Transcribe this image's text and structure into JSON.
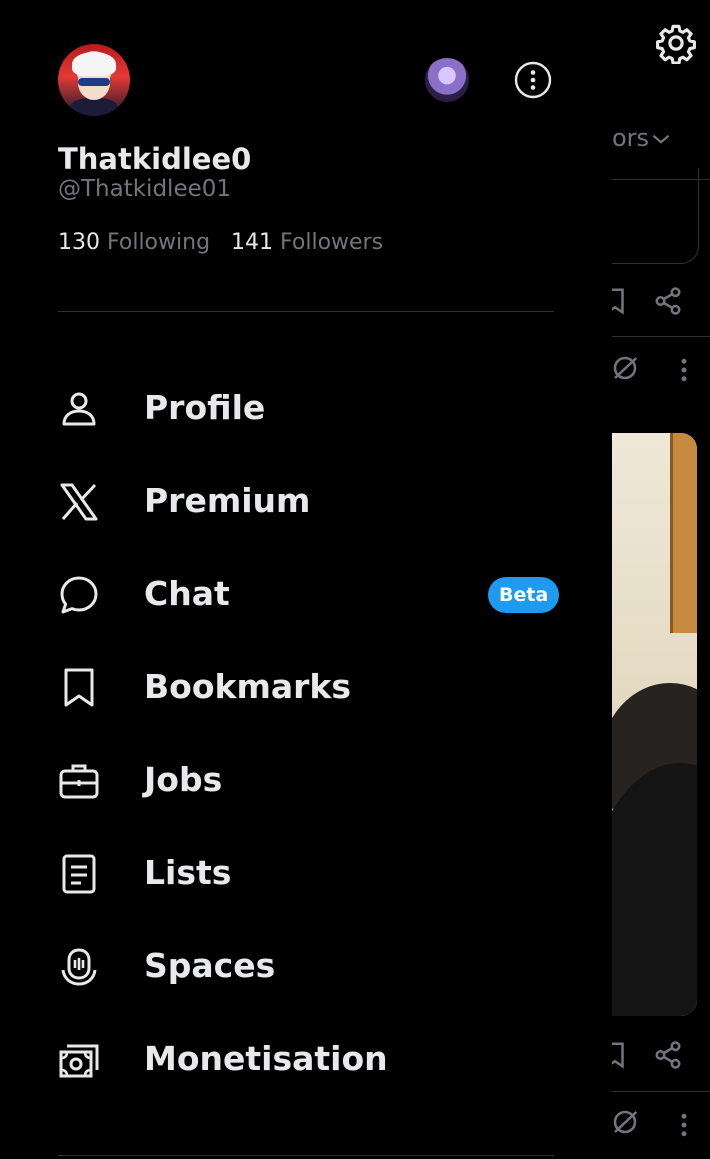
{
  "profile": {
    "display_name": "Thatkidlee0",
    "handle": "@Thatkidlee01",
    "following_count": "130",
    "following_label": "Following",
    "followers_count": "141",
    "followers_label": "Followers"
  },
  "background": {
    "sort_text": "ors"
  },
  "menu": [
    {
      "label": "Profile",
      "icon": "person-icon"
    },
    {
      "label": "Premium",
      "icon": "x-logo-icon"
    },
    {
      "label": "Chat",
      "icon": "chat-bubble-icon",
      "badge": "Beta"
    },
    {
      "label": "Bookmarks",
      "icon": "bookmark-icon"
    },
    {
      "label": "Jobs",
      "icon": "briefcase-icon"
    },
    {
      "label": "Lists",
      "icon": "list-icon"
    },
    {
      "label": "Spaces",
      "icon": "spaces-mic-icon"
    },
    {
      "label": "Monetisation",
      "icon": "money-icon"
    }
  ],
  "colors": {
    "background": "#000000",
    "text_primary": "#e7e9ea",
    "text_secondary": "#71767b",
    "accent": "#1d9bf0",
    "divider": "#2f3336"
  }
}
